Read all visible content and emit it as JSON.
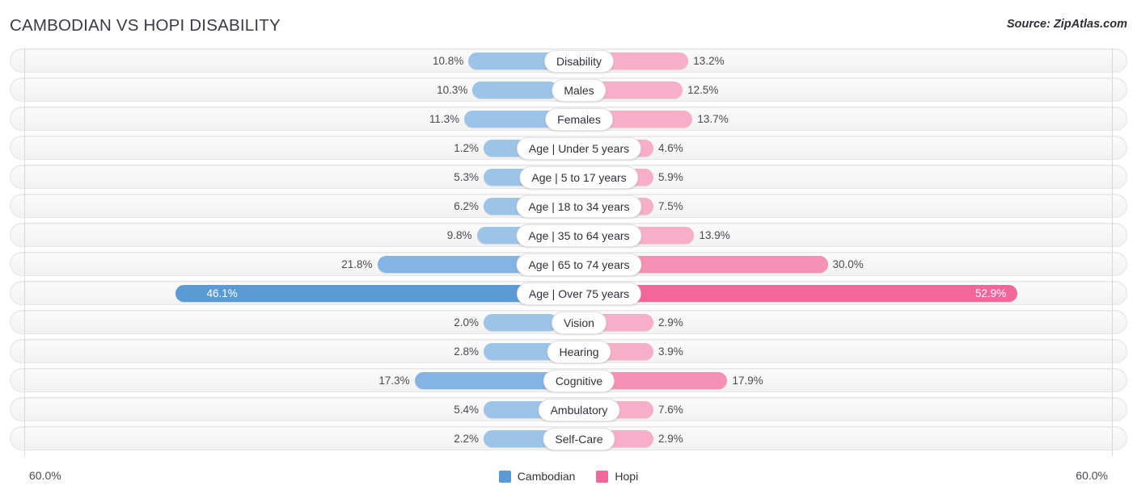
{
  "header": {
    "title": "CAMBODIAN VS HOPI DISABILITY",
    "source": "Source: ZipAtlas.com"
  },
  "axis": {
    "left_label": "60.0%",
    "right_label": "60.0%",
    "max": 60.0
  },
  "legend": {
    "items": [
      {
        "label": "Cambodian",
        "color": "#5b9bd5",
        "icon": "legend-swatch"
      },
      {
        "label": "Hopi",
        "color": "#f2679a",
        "icon": "legend-swatch"
      }
    ]
  },
  "colors": {
    "cambodian_light": "#9cc3e8",
    "cambodian_mid": "#84b4e3",
    "cambodian_strong": "#5b9bd5",
    "hopi_light": "#f7afc9",
    "hopi_mid": "#f591b4",
    "hopi_strong": "#f2679a",
    "track": "#f4f4f4",
    "gridline": "#d8d8d8"
  },
  "chart_data": {
    "type": "bar",
    "title": "CAMBODIAN VS HOPI DISABILITY",
    "subtitle": "Source: ZipAtlas.com",
    "orientation": "horizontal-diverging",
    "xlabel": "",
    "ylabel": "",
    "xlim": [
      -60.0,
      60.0
    ],
    "axis_tick_labels": [
      "60.0%",
      "60.0%"
    ],
    "grid": true,
    "legend_position": "bottom-center",
    "categories": [
      "Disability",
      "Males",
      "Females",
      "Age | Under 5 years",
      "Age | 5 to 17 years",
      "Age | 18 to 34 years",
      "Age | 35 to 64 years",
      "Age | 65 to 74 years",
      "Age | Over 75 years",
      "Vision",
      "Hearing",
      "Cognitive",
      "Ambulatory",
      "Self-Care"
    ],
    "series": [
      {
        "name": "Cambodian",
        "color": "#5b9bd5",
        "values": [
          10.8,
          10.3,
          11.3,
          1.2,
          5.3,
          6.2,
          9.8,
          21.8,
          46.1,
          2.0,
          2.8,
          17.3,
          5.4,
          2.2
        ],
        "labels": [
          "10.8%",
          "10.3%",
          "11.3%",
          "1.2%",
          "5.3%",
          "6.2%",
          "9.8%",
          "21.8%",
          "46.1%",
          "2.0%",
          "2.8%",
          "17.3%",
          "5.4%",
          "2.2%"
        ]
      },
      {
        "name": "Hopi",
        "color": "#f2679a",
        "values": [
          13.2,
          12.5,
          13.7,
          4.6,
          5.9,
          7.5,
          13.9,
          30.0,
          52.9,
          2.9,
          3.9,
          17.9,
          7.6,
          2.9
        ],
        "labels": [
          "13.2%",
          "12.5%",
          "13.7%",
          "4.6%",
          "5.9%",
          "7.5%",
          "13.9%",
          "30.0%",
          "52.9%",
          "2.9%",
          "3.9%",
          "17.9%",
          "7.6%",
          "2.9%"
        ]
      }
    ]
  },
  "rows": [
    {
      "label": "Disability",
      "left_value": 10.8,
      "left_label": "10.8%",
      "right_value": 13.2,
      "right_label": "13.2%",
      "intensity": "light"
    },
    {
      "label": "Males",
      "left_value": 10.3,
      "left_label": "10.3%",
      "right_value": 12.5,
      "right_label": "12.5%",
      "intensity": "light"
    },
    {
      "label": "Females",
      "left_value": 11.3,
      "left_label": "11.3%",
      "right_value": 13.7,
      "right_label": "13.7%",
      "intensity": "light"
    },
    {
      "label": "Age | Under 5 years",
      "left_value": 1.2,
      "left_label": "1.2%",
      "right_value": 4.6,
      "right_label": "4.6%",
      "intensity": "light"
    },
    {
      "label": "Age | 5 to 17 years",
      "left_value": 5.3,
      "left_label": "5.3%",
      "right_value": 5.9,
      "right_label": "5.9%",
      "intensity": "light"
    },
    {
      "label": "Age | 18 to 34 years",
      "left_value": 6.2,
      "left_label": "6.2%",
      "right_value": 7.5,
      "right_label": "7.5%",
      "intensity": "light"
    },
    {
      "label": "Age | 35 to 64 years",
      "left_value": 9.8,
      "left_label": "9.8%",
      "right_value": 13.9,
      "right_label": "13.9%",
      "intensity": "light"
    },
    {
      "label": "Age | 65 to 74 years",
      "left_value": 21.8,
      "left_label": "21.8%",
      "right_value": 30.0,
      "right_label": "30.0%",
      "intensity": "mid"
    },
    {
      "label": "Age | Over 75 years",
      "left_value": 46.1,
      "left_label": "46.1%",
      "right_value": 52.9,
      "right_label": "52.9%",
      "intensity": "strong"
    },
    {
      "label": "Vision",
      "left_value": 2.0,
      "left_label": "2.0%",
      "right_value": 2.9,
      "right_label": "2.9%",
      "intensity": "light"
    },
    {
      "label": "Hearing",
      "left_value": 2.8,
      "left_label": "2.8%",
      "right_value": 3.9,
      "right_label": "3.9%",
      "intensity": "light"
    },
    {
      "label": "Cognitive",
      "left_value": 17.3,
      "left_label": "17.3%",
      "right_value": 17.9,
      "right_label": "17.9%",
      "intensity": "mid"
    },
    {
      "label": "Ambulatory",
      "left_value": 5.4,
      "left_label": "5.4%",
      "right_value": 7.6,
      "right_label": "7.6%",
      "intensity": "light"
    },
    {
      "label": "Self-Care",
      "left_value": 2.2,
      "left_label": "2.2%",
      "right_value": 2.9,
      "right_label": "2.9%",
      "intensity": "light"
    }
  ]
}
